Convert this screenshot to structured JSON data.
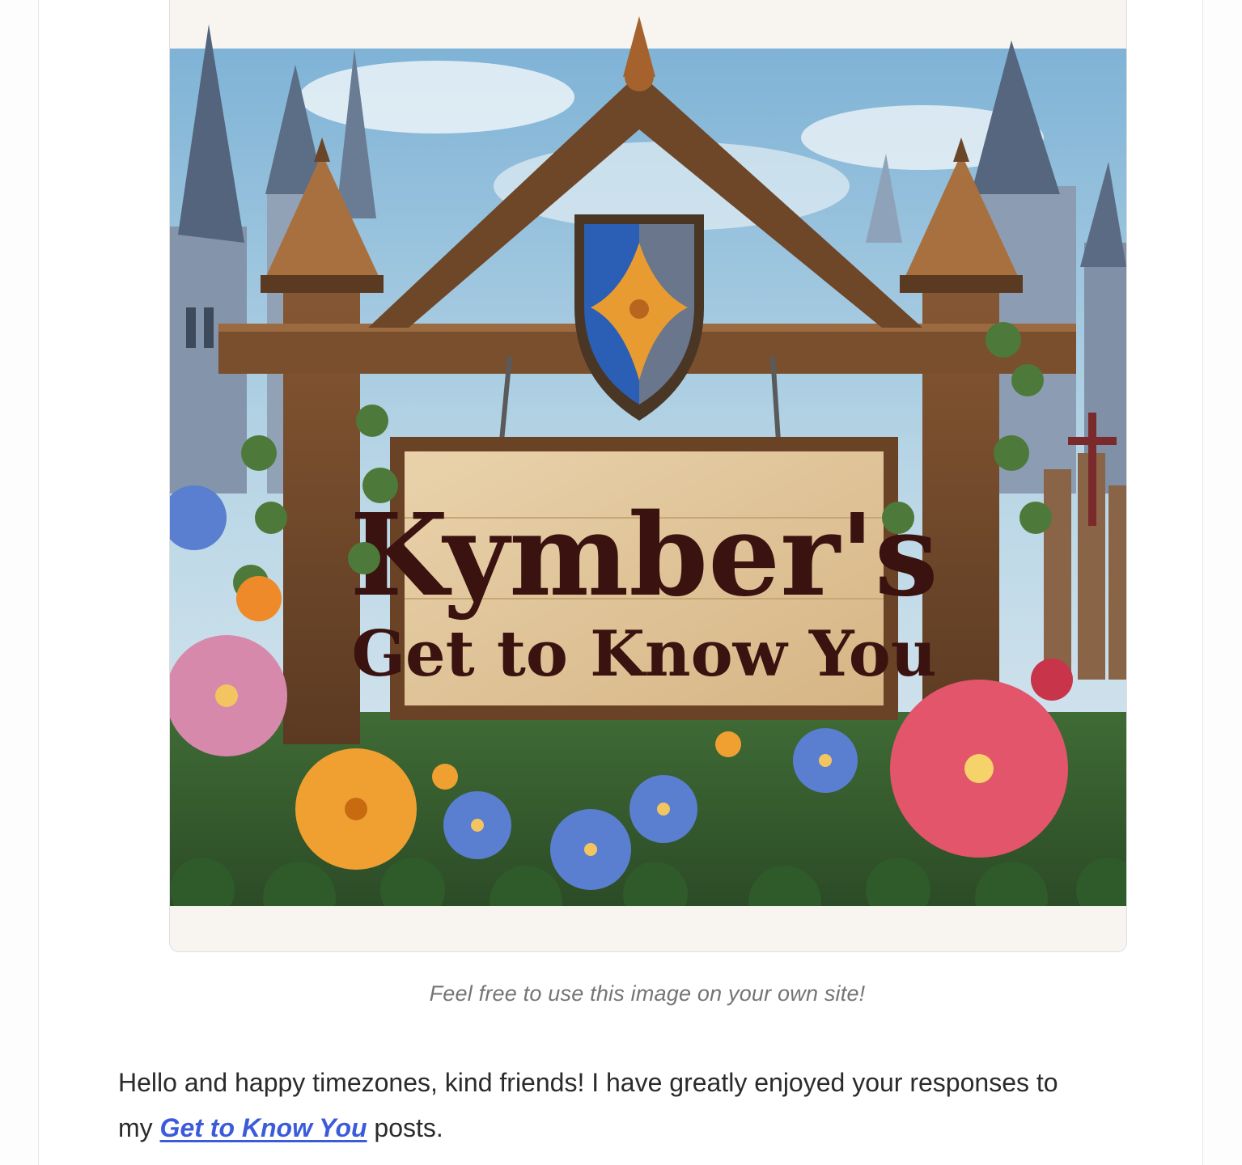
{
  "figure": {
    "sign_title": "Kymber's",
    "sign_subtitle": "Get to Know You",
    "caption": "Feel free to use this image on your own site!"
  },
  "post": {
    "intro_before_line_break": "Hello and happy timezones, kind friends! I have greatly enjoyed your responses to",
    "intro_my": "my",
    "link_text": "Get to Know You",
    "intro_after_link": "posts."
  },
  "colors": {
    "link": "#3b5bdb",
    "caption": "#757575",
    "body_text": "#2b2b2b"
  }
}
